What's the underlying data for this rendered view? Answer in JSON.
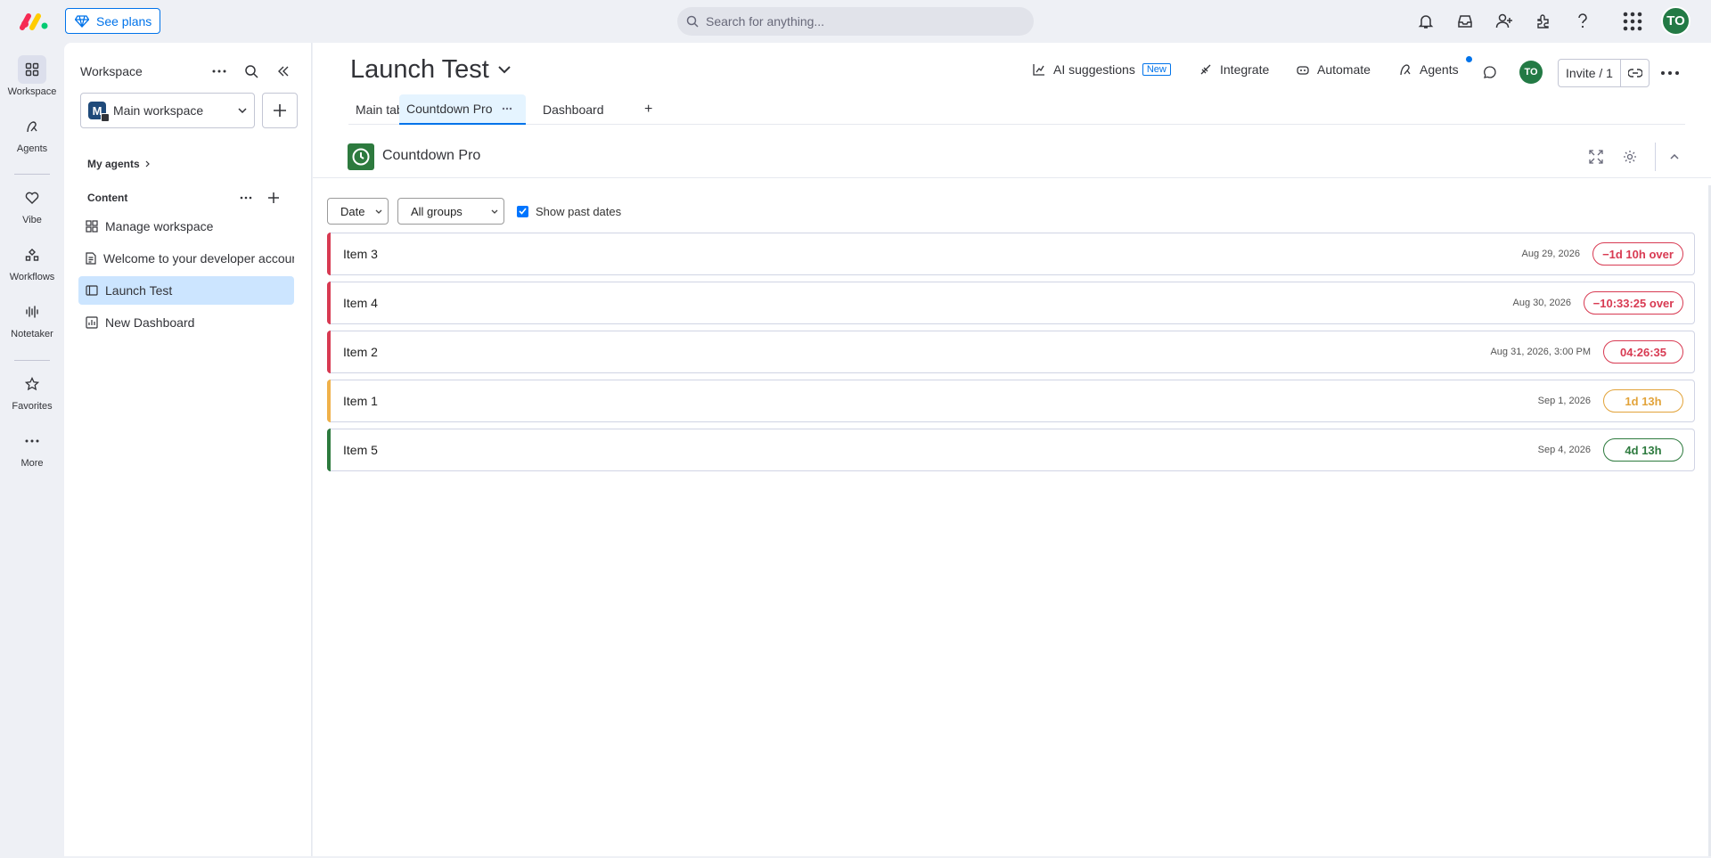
{
  "topbar": {
    "see_plans": "See plans",
    "search_placeholder": "Search for anything...",
    "avatar": "TO"
  },
  "rail": {
    "items": [
      {
        "label": "Workspace"
      },
      {
        "label": "Agents"
      },
      {
        "label": "Vibe"
      },
      {
        "label": "Workflows"
      },
      {
        "label": "Notetaker"
      },
      {
        "label": "Favorites"
      },
      {
        "label": "More"
      }
    ]
  },
  "workspace": {
    "header": "Workspace",
    "selected": "Main workspace",
    "badge": "M",
    "my_agents": "My agents",
    "content": "Content",
    "items": [
      {
        "label": "Manage workspace",
        "icon": "manage-icon"
      },
      {
        "label": "Welcome to your developer account",
        "icon": "doc-icon"
      },
      {
        "label": "Launch Test",
        "icon": "board-icon"
      },
      {
        "label": "New Dashboard",
        "icon": "dashboard-icon"
      }
    ]
  },
  "board": {
    "title": "Launch Test",
    "ai_suggestions": "AI suggestions",
    "new_badge": "New",
    "integrate": "Integrate",
    "automate": "Automate",
    "agents": "Agents",
    "avatar": "TO",
    "invite": "Invite / 1",
    "tabs": [
      {
        "label": "Main table"
      },
      {
        "label": "Countdown Pro"
      },
      {
        "label": "Dashboard"
      }
    ],
    "add_tab": "+"
  },
  "widget": {
    "title": "Countdown Pro",
    "sort_select": "Date",
    "group_select": "All groups",
    "show_past_label": "Show past dates",
    "show_past_checked": true,
    "rows": [
      {
        "name": "Item 3",
        "date": "Aug 29, 2026",
        "countdown": "−1d 10h over",
        "color": "#d83a52",
        "pill_color": "#d83a52"
      },
      {
        "name": "Item 4",
        "date": "Aug 30, 2026",
        "countdown": "−10:33:25 over",
        "color": "#d83a52",
        "pill_color": "#d83a52"
      },
      {
        "name": "Item 2",
        "date": "Aug 31, 2026, 3:00 PM",
        "countdown": "04:26:35",
        "color": "#d83a52",
        "pill_color": "#d83a52"
      },
      {
        "name": "Item 1",
        "date": "Sep 1, 2026",
        "countdown": "1d 13h",
        "color": "#f0b14a",
        "pill_color": "#e2a33a"
      },
      {
        "name": "Item 5",
        "date": "Sep 4, 2026",
        "countdown": "4d 13h",
        "color": "#2d7a3e",
        "pill_color": "#2d7a3e"
      }
    ]
  },
  "colors": {
    "accent": "#0073ea",
    "danger": "#d83a52",
    "warning": "#f0b14a",
    "success": "#2d7a3e"
  }
}
